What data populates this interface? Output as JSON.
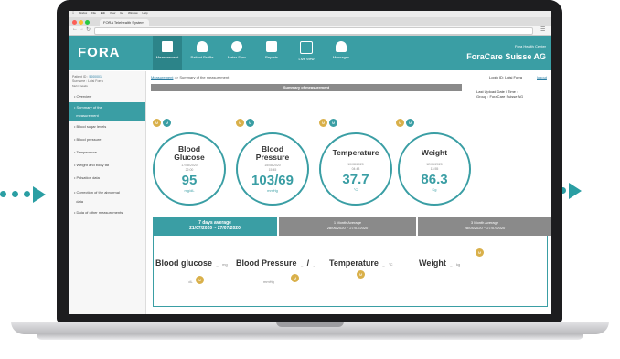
{
  "browser": {
    "menubar": [
      "Firefox",
      "File",
      "Edit",
      "View",
      "Go",
      "Window",
      "Help"
    ],
    "tab_title": "FORA Telehealth System",
    "url_text": "Q"
  },
  "header": {
    "logo": "FORA",
    "nav": [
      {
        "label": "Measurement",
        "icon": "clipboard-icon",
        "active": true
      },
      {
        "label": "Patient Profile",
        "icon": "person-icon",
        "active": false
      },
      {
        "label": "Meter Sync",
        "icon": "sync-icon",
        "active": false
      },
      {
        "label": "Reports",
        "icon": "printer-icon",
        "active": false
      },
      {
        "label": "Live View",
        "icon": "chart-icon",
        "active": false
      },
      {
        "label": "Messages",
        "icon": "message-icon",
        "active": false
      }
    ],
    "user_line": "Fora Health Center",
    "company": "ForaCare Suisse AG"
  },
  "sidebar": {
    "patient_id_label": "Patient ID :",
    "patient_id_value": "5000001",
    "surname_label": "Surname :",
    "surname_value": "Luisi Forra",
    "extra": "Mehr Details",
    "items": [
      {
        "label": "Overview",
        "active": false
      },
      {
        "label": "Summary of the",
        "label2": "measurement",
        "active": true
      },
      {
        "label": "Blood sugar levels",
        "active": false
      },
      {
        "label": "Blood pressure",
        "active": false
      },
      {
        "label": "Temperature",
        "active": false
      },
      {
        "label": "Weight and body fat",
        "active": false
      },
      {
        "label": "Pulsation data",
        "active": false
      },
      {
        "label": "Correction of the abnormal",
        "label2": "data",
        "active": false
      },
      {
        "label": "Data of other measurements",
        "active": false
      }
    ]
  },
  "main": {
    "breadcrumb_link": "Measurement",
    "breadcrumb_rest": ">> Summary of the measurement",
    "login": "Login ID: Luisi Forra",
    "logout": "logout",
    "summary_title": "Summary of measurement",
    "last_upload_label": "Last Upload Date / Time :",
    "group_label": "Group : ForaCare Suisse AG",
    "badges": [
      "Ⓜ",
      "Ⓜ"
    ],
    "measurements": [
      {
        "title1": "Blood",
        "title2": "Glucose",
        "date": "17/08/2020",
        "time": "22:00",
        "value": "95",
        "unit": "mg/dL"
      },
      {
        "title1": "Blood",
        "title2": "Pressure",
        "date": "15/08/2020",
        "time": "15:45",
        "value": "103",
        "value2": "69",
        "unit": "mmHg"
      },
      {
        "title1": "Temperature",
        "title2": "",
        "date": "10/08/2020",
        "time": "04:43",
        "value": "37.7",
        "unit": "°C"
      },
      {
        "title1": "Weight",
        "title2": "",
        "date": "12/06/2020",
        "time": "13:55",
        "value": "86.3",
        "unit": "Kg"
      }
    ],
    "average_tabs": [
      {
        "title": "7 days average",
        "range": "21/07/2020 ~ 27/07/2020",
        "selected": true
      },
      {
        "title": "1 Month Average",
        "range": "28/06/2020 ~ 27/07/2020",
        "selected": false
      },
      {
        "title": "3 Month Average",
        "range": "28/04/2020 ~ 27/07/2020",
        "selected": false
      }
    ],
    "averages": [
      {
        "label": "Blood glucose",
        "value": "_",
        "unit": "mg",
        "unit2": "/ dL"
      },
      {
        "label": "Blood Pressure",
        "value": "_",
        "sep": "/",
        "value2": "_",
        "unit": "mmHg"
      },
      {
        "label": "Temperature",
        "value": "_",
        "unit": "°C"
      },
      {
        "label": "Weight",
        "value": "_",
        "unit": "kg"
      }
    ]
  },
  "colors": {
    "teal": "#3a9ea4",
    "gold": "#d9b04a",
    "gray_bar": "#8a8a8a"
  }
}
